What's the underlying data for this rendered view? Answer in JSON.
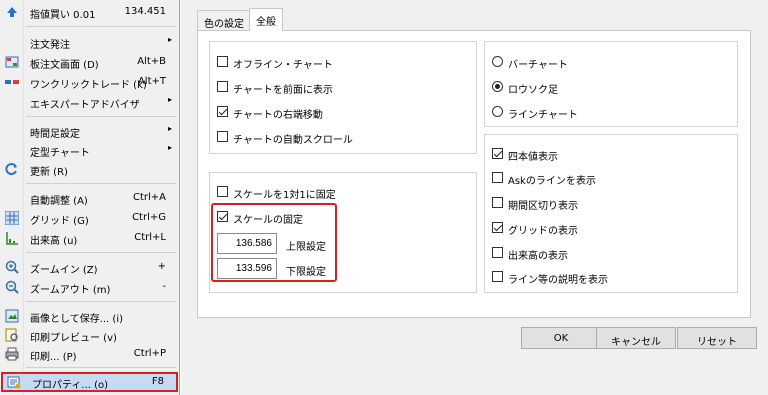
{
  "menu": {
    "items": [
      {
        "label": "指値買い 0.01",
        "shortcut": "134.451",
        "icon": "arrow-up-icon"
      },
      {
        "label": "注文発注",
        "submenu": true
      },
      {
        "label": "板注文画面 (D)",
        "shortcut": "Alt+B",
        "icon": "order-board-icon"
      },
      {
        "label": "ワンクリックトレード (k)",
        "shortcut": "Alt+T",
        "icon": "one-click-trade-icon"
      },
      {
        "label": "エキスパートアドバイザ",
        "submenu": true
      },
      {
        "label": "時間足設定",
        "submenu": true
      },
      {
        "label": "定型チャート",
        "submenu": true
      },
      {
        "label": "更新 (R)",
        "icon": "refresh-icon"
      },
      {
        "label": "自動調整 (A)",
        "shortcut": "Ctrl+A"
      },
      {
        "label": "グリッド (G)",
        "shortcut": "Ctrl+G",
        "icon": "grid-icon"
      },
      {
        "label": "出来高 (u)",
        "shortcut": "Ctrl+L",
        "icon": "volume-icon"
      },
      {
        "label": "ズームイン (Z)",
        "shortcut": "+",
        "icon": "zoom-in-icon"
      },
      {
        "label": "ズームアウト (m)",
        "shortcut": "-",
        "icon": "zoom-out-icon"
      },
      {
        "label": "画像として保存... (i)",
        "icon": "save-image-icon"
      },
      {
        "label": "印刷プレビュー (v)",
        "icon": "print-preview-icon"
      },
      {
        "label": "印刷... (P)",
        "shortcut": "Ctrl+P",
        "icon": "printer-icon"
      },
      {
        "label": "プロパティ... (o)",
        "shortcut": "F8",
        "icon": "properties-icon"
      }
    ]
  },
  "dialog": {
    "tabs": [
      "色の設定",
      "全般"
    ],
    "active_tab": "全般",
    "left_options": [
      {
        "label": "オフライン・チャート",
        "checked": false
      },
      {
        "label": "チャートを前面に表示",
        "checked": false
      },
      {
        "label": "チャートの右端移動",
        "checked": true
      },
      {
        "label": "チャートの自動スクロール",
        "checked": false
      }
    ],
    "scale_options": [
      {
        "label": "スケールを1対1に固定",
        "checked": false
      },
      {
        "label": "スケールの固定",
        "checked": true
      }
    ],
    "upper_value": "136.586",
    "upper_label": "上限設定",
    "lower_value": "133.596",
    "lower_label": "下限設定",
    "chart_types": [
      {
        "label": "バーチャート",
        "selected": false
      },
      {
        "label": "ロウソク足",
        "selected": true
      },
      {
        "label": "ラインチャート",
        "selected": false
      }
    ],
    "display_options": [
      {
        "label": "四本値表示",
        "checked": true
      },
      {
        "label": "Askのラインを表示",
        "checked": false
      },
      {
        "label": "期間区切り表示",
        "checked": false
      },
      {
        "label": "グリッドの表示",
        "checked": true
      },
      {
        "label": "出来高の表示",
        "checked": false
      },
      {
        "label": "ライン等の説明を表示",
        "checked": false
      }
    ],
    "buttons": {
      "ok": "OK",
      "cancel": "キャンセル",
      "reset": "リセット"
    }
  },
  "colors": {
    "highlight_border": "#d92020",
    "highlight_fill": "#c6dbf1"
  }
}
